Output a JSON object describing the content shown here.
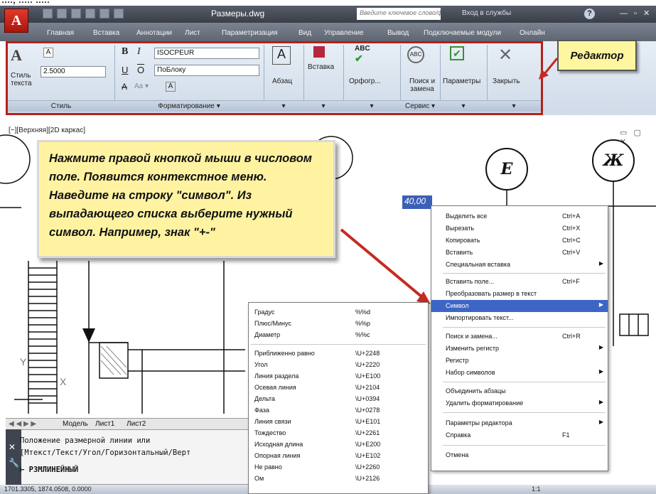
{
  "top_strip": {
    "text": "...., ..... ....."
  },
  "titlebar": {
    "doc_title": "Размеры.dwg",
    "search_placeholder": "Введите ключевое слово/фразу",
    "signin": "Вход в службы",
    "help": "?"
  },
  "tabs": [
    "Главная",
    "Вставка",
    "Аннотации",
    "Лист",
    "Параметризация",
    "Вид",
    "Управление",
    "Вывод",
    "Подключаемые модули",
    "Онлайн"
  ],
  "ribbon": {
    "style_panel": {
      "button": "Стиль текста",
      "height_value": "2.5000",
      "label": "Стиль"
    },
    "format_panel": {
      "font": "ISOCPEUR",
      "layer": "ПоБлоку",
      "label": "Форматирование"
    },
    "paragraph": "Абзац",
    "insert": "Вставка",
    "spell": "Орфогр...",
    "find": "Поиск и замена",
    "service_label": "Сервис",
    "options": "Параметры",
    "close": "Закрыть"
  },
  "editor_callout": "Редактор",
  "viewport": {
    "label": "[−][Верхняя][2D каркас]",
    "bubble_e": "Е",
    "bubble_zh": "Ж",
    "dim_value": "40,00"
  },
  "instruction": "Нажмите правой кнопкой мыши в числовом поле. Появится контекстное меню. Наведите на строку \"символ\". Из выпадающего списка выберите нужный символ. Например, знак \"+-\"",
  "context_menu": [
    {
      "label": "Выделить все",
      "shortcut": "Ctrl+A"
    },
    {
      "label": "Вырезать",
      "shortcut": "Ctrl+X"
    },
    {
      "label": "Копировать",
      "shortcut": "Ctrl+C"
    },
    {
      "label": "Вставить",
      "shortcut": "Ctrl+V"
    },
    {
      "label": "Специальная вставка",
      "shortcut": ""
    },
    {
      "label": "Вставить поле...",
      "shortcut": "Ctrl+F"
    },
    {
      "label": "Преобразовать размер в текст",
      "shortcut": ""
    },
    {
      "label": "Символ",
      "shortcut": ""
    },
    {
      "label": "Импортировать текст...",
      "shortcut": ""
    },
    {
      "label": "Поиск и замена...",
      "shortcut": "Ctrl+R"
    },
    {
      "label": "Изменить регистр",
      "shortcut": ""
    },
    {
      "label": "Регистр",
      "shortcut": ""
    },
    {
      "label": "Набор символов",
      "shortcut": ""
    },
    {
      "label": "Объединить абзацы",
      "shortcut": ""
    },
    {
      "label": "Удалить форматирование",
      "shortcut": ""
    },
    {
      "label": "Параметры редактора",
      "shortcut": ""
    },
    {
      "label": "Справка",
      "shortcut": "F1"
    },
    {
      "label": "Отмена",
      "shortcut": ""
    }
  ],
  "symbol_menu": [
    {
      "label": "Градус",
      "code": "%%d"
    },
    {
      "label": "Плюс/Минус",
      "code": "%%p"
    },
    {
      "label": "Диаметр",
      "code": "%%c"
    },
    {
      "label": "Приближенно равно",
      "code": "\\U+2248"
    },
    {
      "label": "Угол",
      "code": "\\U+2220"
    },
    {
      "label": "Линия раздела",
      "code": "\\U+E100"
    },
    {
      "label": "Осевая линия",
      "code": "\\U+2104"
    },
    {
      "label": "Дельта",
      "code": "\\U+0394"
    },
    {
      "label": "Фаза",
      "code": "\\U+0278"
    },
    {
      "label": "Линия связи",
      "code": "\\U+E101"
    },
    {
      "label": "Тождество",
      "code": "\\U+2261"
    },
    {
      "label": "Исходная длина",
      "code": "\\U+E200"
    },
    {
      "label": "Опорная линия",
      "code": "\\U+E102"
    },
    {
      "label": "Не равно",
      "code": "\\U+2260"
    },
    {
      "label": "Ом",
      "code": "\\U+2126"
    }
  ],
  "layout_tabs": [
    "Модель",
    "Лист1",
    "Лист2"
  ],
  "command": {
    "line1": "Положение размерной линии или",
    "line2": "[Мтекст/Текст/Угол/Горизонтальный/Верт",
    "prompt": "РЗМЛИНЕЙНЫЙ"
  },
  "status": {
    "coords": "1701.3305, 1874.0508, 0.0000",
    "scale": "1:1"
  },
  "colors": {
    "highlight": "#3d66c4",
    "callout_bg": "#fff3a2",
    "ribbon_border": "#b5201b"
  }
}
